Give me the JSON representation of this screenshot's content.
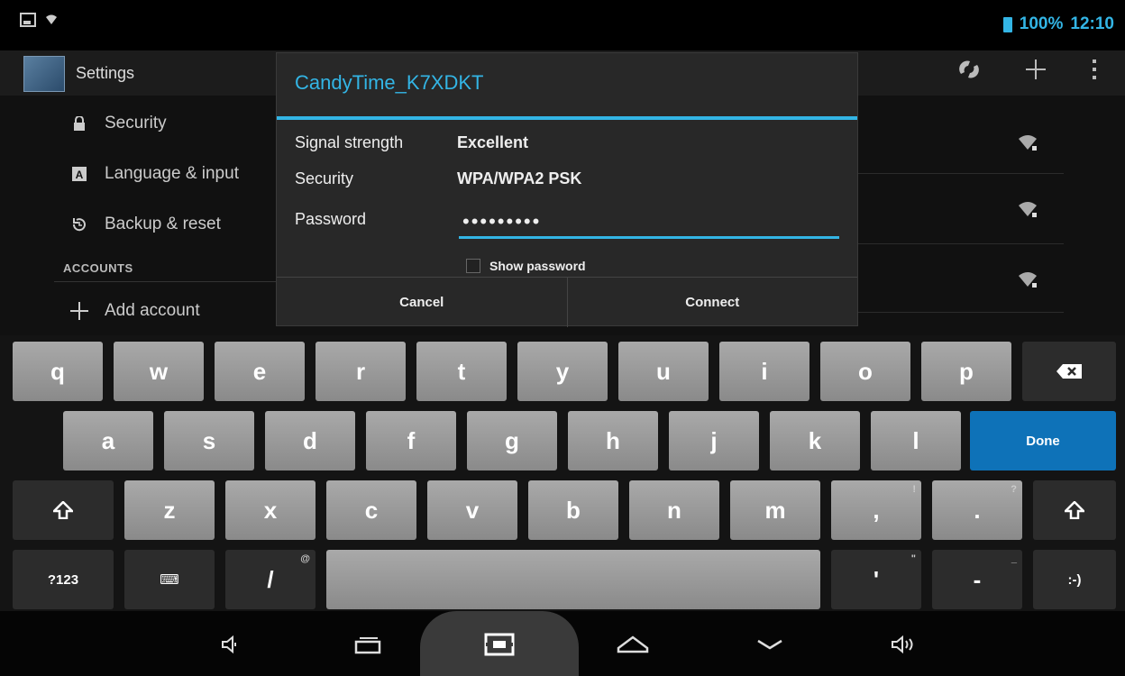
{
  "status_bar": {
    "battery": "100%",
    "time": "12:10"
  },
  "action_bar": {
    "title": "Settings"
  },
  "settings": {
    "items": [
      {
        "label": "Security",
        "icon": "lock-icon"
      },
      {
        "label": "Language & input",
        "icon": "keyboard-icon"
      },
      {
        "label": "Backup & reset",
        "icon": "restore-icon"
      }
    ],
    "accounts_header": "ACCOUNTS",
    "add_account": "Add account"
  },
  "dialog": {
    "title": "CandyTime_K7XDKT",
    "signal_label": "Signal strength",
    "signal_value": "Excellent",
    "security_label": "Security",
    "security_value": "WPA/WPA2 PSK",
    "password_label": "Password",
    "password_value": "•••••••••",
    "show_password": "Show password",
    "cancel": "Cancel",
    "connect": "Connect"
  },
  "keyboard": {
    "row1": [
      "q",
      "w",
      "e",
      "r",
      "t",
      "y",
      "u",
      "i",
      "o",
      "p"
    ],
    "row2": [
      "a",
      "s",
      "d",
      "f",
      "g",
      "h",
      "j",
      "k",
      "l"
    ],
    "row3": [
      "z",
      "x",
      "c",
      "v",
      "b",
      "n",
      "m"
    ],
    "done": "Done",
    "symbols": "?123",
    "lang": "⌨",
    "slash": "/",
    "slash_hint": "@",
    "comma": ",",
    "comma_hint": "!",
    "period": ".",
    "period_hint": "?",
    "apostrophe": "'",
    "apostrophe_hint": "\"",
    "dash": "-",
    "dash_hint": "_",
    "smiley": ":-)"
  },
  "colors": {
    "accent": "#33b5e5",
    "done_key": "#0e72b8"
  }
}
